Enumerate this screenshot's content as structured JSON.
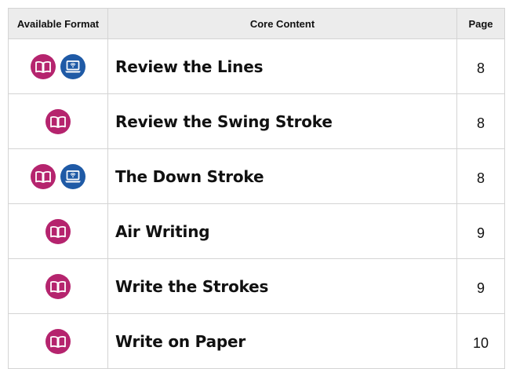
{
  "columns": {
    "format": "Available Format",
    "content": "Core Content",
    "page": "Page"
  },
  "colors": {
    "book": "#b5246e",
    "digital": "#1f5aa6",
    "header_bg": "#ececec",
    "border": "#d4d4d4"
  },
  "rows": [
    {
      "formats": [
        "book-icon",
        "laptop-wifi-icon"
      ],
      "content": "Review the Lines",
      "page": "8"
    },
    {
      "formats": [
        "book-icon"
      ],
      "content": "Review the Swing Stroke",
      "page": "8"
    },
    {
      "formats": [
        "book-icon",
        "laptop-wifi-icon"
      ],
      "content": "The Down Stroke",
      "page": "8"
    },
    {
      "formats": [
        "book-icon"
      ],
      "content": "Air Writing",
      "page": "9"
    },
    {
      "formats": [
        "book-icon"
      ],
      "content": "Write the Strokes",
      "page": "9"
    },
    {
      "formats": [
        "book-icon"
      ],
      "content": "Write on Paper",
      "page": "10"
    }
  ]
}
